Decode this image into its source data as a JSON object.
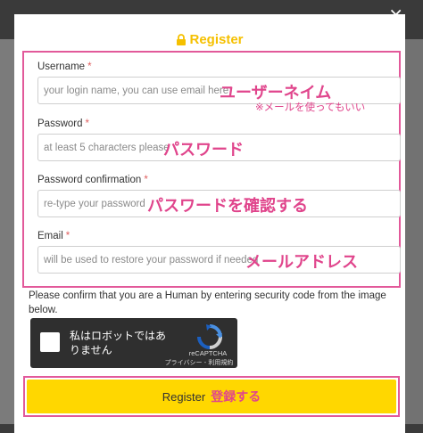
{
  "modal": {
    "title": "Register",
    "close_symbol": "×"
  },
  "fields": {
    "username": {
      "label": "Username",
      "required_mark": "*",
      "placeholder": "your login name, you can use email here",
      "annotation": "ユーザーネイム",
      "annotation_note": "※メールを使ってもいい"
    },
    "password": {
      "label": "Password",
      "required_mark": "*",
      "placeholder": "at least 5 characters please",
      "annotation": "パスワード"
    },
    "password_confirmation": {
      "label": "Password confirmation",
      "required_mark": "*",
      "placeholder": "re-type your password",
      "annotation": "パスワードを確認する"
    },
    "email": {
      "label": "Email",
      "required_mark": "*",
      "placeholder": "will be used to restore your password if needed",
      "annotation": "メールアドレス"
    }
  },
  "confirm_text": "Please confirm that you are a Human by entering security code from the image below.",
  "captcha": {
    "checkbox_label": "私はロボットではありません",
    "brand": "reCAPTCHA",
    "privacy_terms": "プライバシー - 利用規約"
  },
  "submit": {
    "label": "Register",
    "annotation": "登録する"
  },
  "colors": {
    "accent_yellow": "#ffd700",
    "annotation_pink": "#e0458c"
  }
}
